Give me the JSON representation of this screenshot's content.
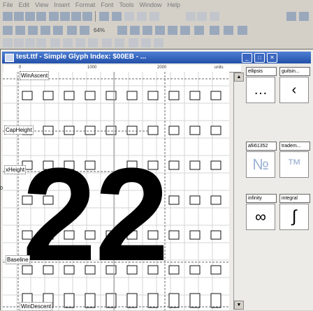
{
  "menu": [
    "File",
    "Edit",
    "View",
    "Insert",
    "Format",
    "Font",
    "Tools",
    "Window",
    "Help"
  ],
  "window": {
    "title": "test.ttf - Simple Glyph Index: $00EB - ..."
  },
  "ruler": {
    "ticks": [
      "0",
      "1000",
      "2000"
    ],
    "units": "units"
  },
  "metrics": {
    "win_ascent": "WinAscent",
    "cap_height": "CapHeight",
    "x_height": "xHeight",
    "baseline": "Baseline",
    "win_descent": "WinDescent",
    "origin_y": "0"
  },
  "glyph": {
    "text": "2"
  },
  "panel": {
    "rows": [
      {
        "left_name": "ellipsis",
        "right_name": "guilsin...",
        "left_glyph": "…",
        "right_glyph": "‹"
      },
      {
        "left_name": "afii61352",
        "right_name": "tradem...",
        "left_glyph": "№",
        "right_glyph": "™"
      },
      {
        "left_name": "infinity",
        "right_name": "integral",
        "left_glyph": "∞",
        "right_glyph": "∫"
      }
    ]
  },
  "toolbar3": {
    "zoom": "64%"
  }
}
